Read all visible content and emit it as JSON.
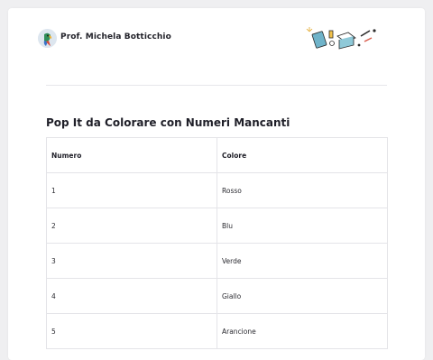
{
  "author": {
    "name": "Prof. Michela Botticchio",
    "avatar_icon": "parrot-avatar-icon"
  },
  "header_illustration": "school-supplies-doodle-icon",
  "page": {
    "title": "Pop It da Colorare con Numeri Mancanti"
  },
  "table": {
    "headers": [
      "Numero",
      "Colore"
    ],
    "rows": [
      [
        "1",
        "Rosso"
      ],
      [
        "2",
        "Blu"
      ],
      [
        "3",
        "Verde"
      ],
      [
        "4",
        "Giallo"
      ],
      [
        "5",
        "Arancione"
      ]
    ]
  }
}
